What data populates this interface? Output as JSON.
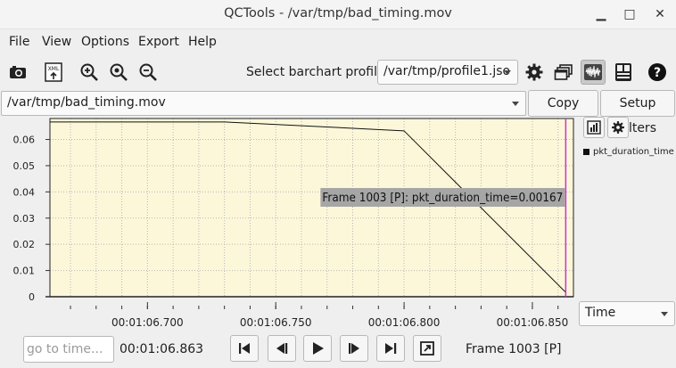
{
  "window": {
    "title": "QCTools - /var/tmp/bad_timing.mov",
    "minimize_glyph": "▁",
    "maximize_glyph": "□",
    "close_glyph": "✕"
  },
  "menu": {
    "items": [
      "File",
      "View",
      "Options",
      "Export",
      "Help"
    ]
  },
  "toolbar": {
    "icons": [
      "camera-icon",
      "xml-export-icon",
      "zoom-in-icon",
      "zoom-reset-icon",
      "zoom-out-icon",
      "gear-icon",
      "windows-icon",
      "waveform-icon",
      "panels-icon",
      "help-icon"
    ],
    "profile_label": "Select barchart profile:",
    "profile_value": "/var/tmp/profile1.jso"
  },
  "file_row": {
    "file_value": "/var/tmp/bad_timing.mov",
    "copy_label": "Copy",
    "setup_filters_label": "Setup Filters"
  },
  "plot": {
    "tooltip": "Frame 1003 [P]: pkt_duration_time=0.00167",
    "legend_label": "pkt_duration_time",
    "x_axis_mode": "Time",
    "colors": {
      "background": "#fdf7da",
      "grid": "#b5b5b5",
      "line": "#111111",
      "cursor": "#cc33cc",
      "tooltip_bg": "#a6a6a6"
    }
  },
  "chart_data": {
    "type": "line",
    "title": "",
    "xlabel": "",
    "ylabel": "",
    "series": [
      {
        "name": "pkt_duration_time",
        "x": [
          "00:01:06.662",
          "00:01:06.730",
          "00:01:06.800",
          "00:01:06.863"
        ],
        "y": [
          0.0667,
          0.0667,
          0.0633,
          0.00167
        ]
      }
    ],
    "x_ticks": [
      "00:01:06.700",
      "00:01:06.750",
      "00:01:06.800",
      "00:01:06.850"
    ],
    "y_ticks": [
      "0",
      "0.01",
      "0.02",
      "0.03",
      "0.04",
      "0.05",
      "0.06"
    ],
    "x_range_seconds": [
      66.662,
      66.866
    ],
    "ylim": [
      0,
      0.068
    ],
    "grid": true,
    "cursor_x": "00:01:06.863"
  },
  "bottom": {
    "goto_placeholder": "go to time...",
    "timestamp": "00:01:06.863",
    "frame_label": "Frame 1003 [P]"
  }
}
